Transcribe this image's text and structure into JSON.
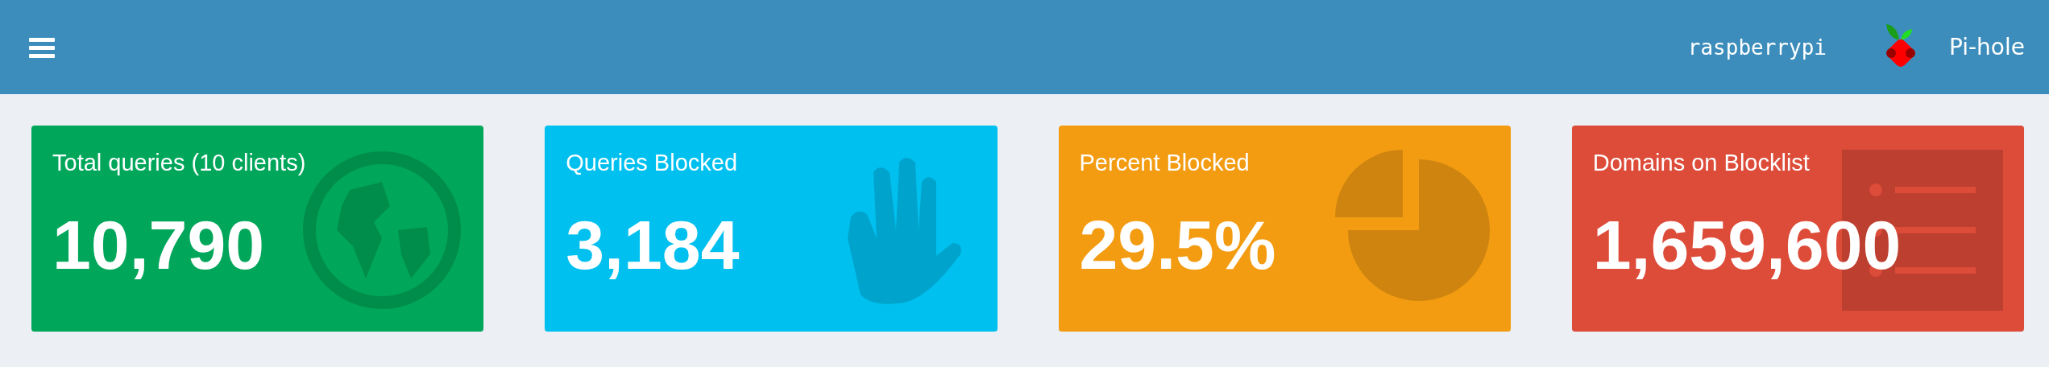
{
  "header": {
    "hostname": "raspberrypi",
    "brand": "Pi-hole"
  },
  "cards": [
    {
      "title": "Total queries (10 clients)",
      "value": "10,790",
      "kind": "globe",
      "color": "#00a65a"
    },
    {
      "title": "Queries Blocked",
      "value": "3,184",
      "kind": "hand",
      "color": "#00c0ef"
    },
    {
      "title": "Percent Blocked",
      "value": "29.5%",
      "kind": "pie",
      "color": "#f39c12"
    },
    {
      "title": "Domains on Blocklist",
      "value": "1,659,600",
      "kind": "list",
      "color": "#dd4b39"
    }
  ]
}
